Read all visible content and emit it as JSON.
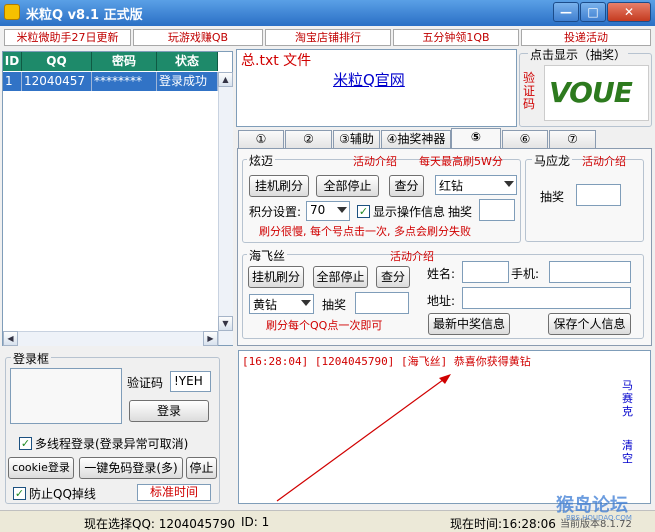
{
  "window": {
    "title": "米粒Q v8.1 正式版",
    "min": "—",
    "max": "□",
    "close": "✕"
  },
  "top_links": [
    "米粒微助手27日更新",
    "玩游戏赚QB",
    "淘宝店铺排行",
    "五分钟领1QB",
    "投递活动"
  ],
  "accounts": {
    "columns": [
      "ID",
      "QQ",
      "密码",
      "状态"
    ],
    "rows": [
      {
        "id": "1",
        "qq": "12040457",
        "password": "********",
        "status": "登录成功"
      }
    ]
  },
  "notice": {
    "text": "总.txt   文件",
    "link": "米粒Q官网"
  },
  "captcha": {
    "title": "点击显示（抽奖）",
    "label": "验证码",
    "image_text": "VOUE"
  },
  "tabs": [
    "①",
    "②",
    "③辅助",
    "④抽奖神器",
    "⑤",
    "⑥",
    "⑦"
  ],
  "xuanmai": {
    "title": "炫迈",
    "promo": "活动介绍",
    "promo2": "每天最高刷5W分",
    "start_btn": "挂机刷分",
    "stop_btn": "全部停止",
    "query_btn": "查分",
    "select_value": "红钻",
    "score_label": "积分设置:",
    "score_value": "70",
    "show_info_label": "显示操作信息",
    "show_info_checked": true,
    "lottery_label": "抽奖",
    "note": "刷分很慢, 每个号点击一次, 多点会刷分失败"
  },
  "maying": {
    "title": "马应龙",
    "promo": "活动介绍",
    "lottery_label": "抽奖"
  },
  "haifei": {
    "title": "海飞丝",
    "promo": "活动介绍",
    "start_btn": "挂机刷分",
    "stop_btn": "全部停止",
    "query_btn": "查分",
    "select_value": "黄钻",
    "lottery_label": "抽奖",
    "note": "刷分每个QQ点一次即可",
    "name_label": "姓名:",
    "phone_label": "手机:",
    "address_label": "地址:",
    "latest_btn": "最新中奖信息",
    "save_btn": "保存个人信息"
  },
  "login": {
    "title": "登录框",
    "captcha_label": "验证码",
    "captcha_value": "!YEH",
    "login_btn": "登录",
    "multithread_label": "多线程登录(登录异常可取消)",
    "multithread_checked": true,
    "cookie_btn": "cookie登录",
    "onekey_btn": "一键免码登录(多)",
    "stop_btn": "停止",
    "prevent_drop_label": "防止QQ掉线",
    "prevent_drop_checked": true,
    "std_time_btn": "标准时间"
  },
  "log": {
    "line": "[16:28:04] [1204045790] [海飞丝] 恭喜你获得黄钻",
    "side_button_1": "马赛克",
    "side_button_2": "清空"
  },
  "status": {
    "current_qq": "现在选择QQ: 1204045790",
    "id": "ID: 1",
    "time": "现在时间:16:28:06",
    "version": "当前版本8.1.72"
  },
  "watermark": {
    "text": "猴岛论坛",
    "url": "BBS.HOUDAO.COM"
  },
  "colors": {
    "title_bar": "#2a6fc5",
    "header_row": "#1e8a6a",
    "selected_row": "#3173c6",
    "promo_red": "#d00000"
  }
}
